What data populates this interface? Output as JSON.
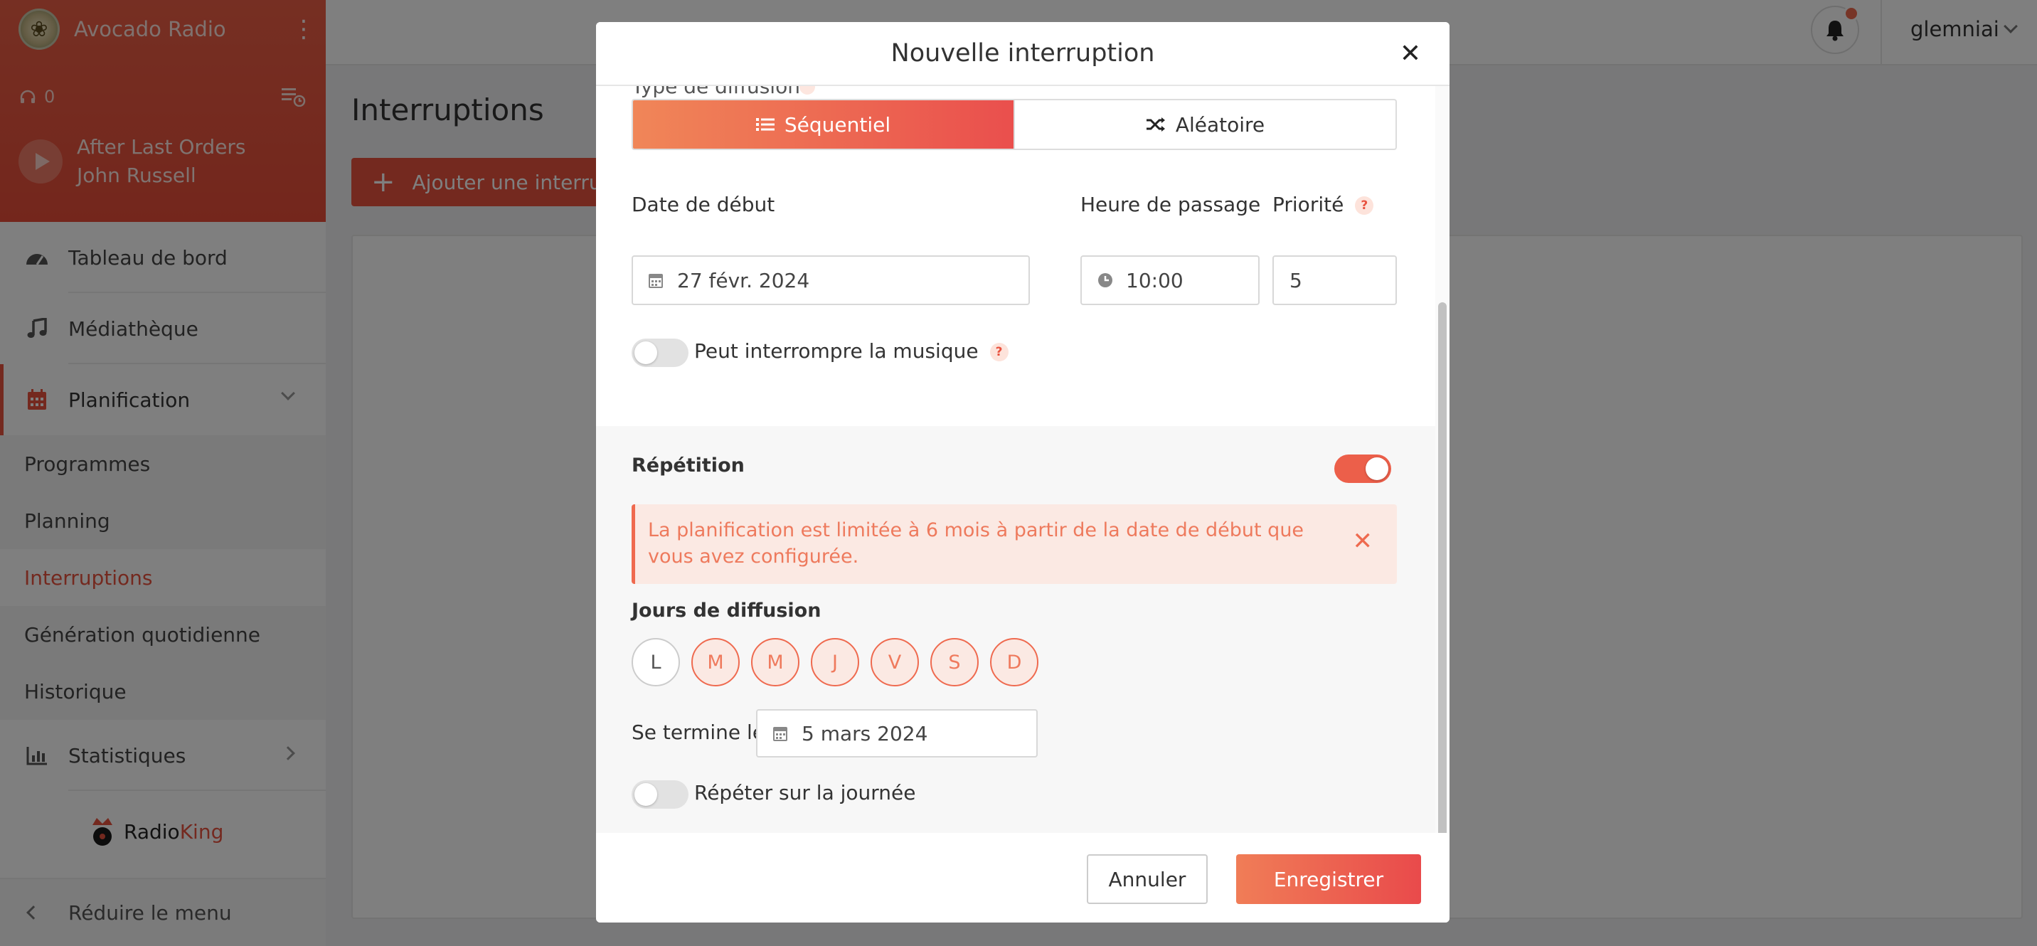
{
  "radio": {
    "name": "Avocado Radio",
    "listeners": "0",
    "now_playing": {
      "title": "After Last Orders",
      "artist": "John Russell"
    }
  },
  "sidebar": {
    "items": [
      {
        "label": "Tableau de bord",
        "icon": "dashboard-icon"
      },
      {
        "label": "Médiathèque",
        "icon": "music-note-icon"
      },
      {
        "label": "Planification",
        "icon": "calendar-icon"
      }
    ],
    "subitems": [
      "Programmes",
      "Planning",
      "Interruptions",
      "Génération quotidienne",
      "Historique"
    ],
    "active_subitem": "Interruptions",
    "stats_label": "Statistiques",
    "brand": {
      "part1": "Radio",
      "part2": "King"
    },
    "collapse_label": "Réduire le menu"
  },
  "topbar": {
    "username": "glemniai"
  },
  "page": {
    "title": "Interruptions",
    "add_button": "Ajouter une interrupt"
  },
  "modal": {
    "title": "Nouvelle interruption",
    "cut_label": "Type de diffusion",
    "broadcast_type": {
      "options": [
        "Séquentiel",
        "Aléatoire"
      ],
      "selected": "Séquentiel"
    },
    "start_date": {
      "label": "Date de début",
      "value": "27 févr. 2024"
    },
    "time": {
      "label": "Heure de passage",
      "value": "10:00"
    },
    "priority": {
      "label": "Priorité",
      "value": "5"
    },
    "interrupt_music": {
      "label": "Peut interrompre la musique",
      "on": false
    },
    "repetition": {
      "label": "Répétition",
      "on": true,
      "alert": "La planification est limitée à 6 mois à partir de la date de début que vous avez configurée.",
      "days_label": "Jours de diffusion",
      "days": [
        {
          "label": "L",
          "selected": false
        },
        {
          "label": "M",
          "selected": true
        },
        {
          "label": "M",
          "selected": true
        },
        {
          "label": "J",
          "selected": true
        },
        {
          "label": "V",
          "selected": true
        },
        {
          "label": "S",
          "selected": true
        },
        {
          "label": "D",
          "selected": true
        }
      ],
      "end_label": "Se termine le",
      "end_date": "5 mars 2024",
      "repeat_day_label": "Répéter sur la journée",
      "repeat_day_on": false
    },
    "cancel": "Annuler",
    "save": "Enregistrer"
  },
  "colors": {
    "accent": "#e8523f",
    "accent_light": "#fbe9e3",
    "overlay": "rgba(0,0,0,0.5)"
  }
}
